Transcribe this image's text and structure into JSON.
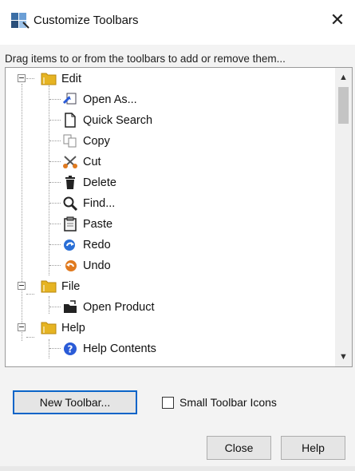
{
  "window": {
    "title": "Customize Toolbars",
    "close_glyph": "✕"
  },
  "instructions": "Drag items to or from the toolbars to add or remove them...",
  "tree": {
    "groups": [
      {
        "label": "Edit",
        "items": [
          "Open As...",
          "Quick Search",
          "Copy",
          "Cut",
          "Delete",
          "Find...",
          "Paste",
          "Redo",
          "Undo"
        ]
      },
      {
        "label": "File",
        "items": [
          "Open Product"
        ]
      },
      {
        "label": "Help",
        "items": [
          "Help Contents"
        ]
      }
    ]
  },
  "scrollbar": {
    "up_glyph": "▲",
    "down_glyph": "▼"
  },
  "buttons": {
    "new_toolbar": "New Toolbar...",
    "close": "Close",
    "help": "Help"
  },
  "checkbox": {
    "label": "Small Toolbar Icons",
    "checked": false
  },
  "colors": {
    "focus_border": "#0a64c8",
    "folder": "#e6b422"
  }
}
